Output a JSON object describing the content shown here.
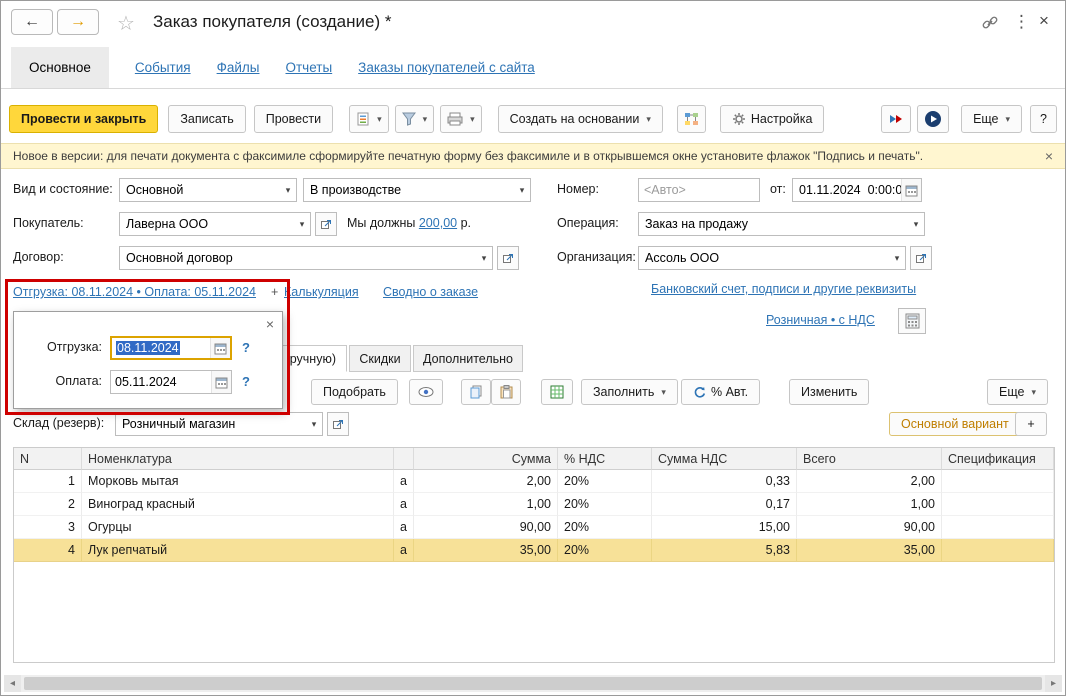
{
  "header": {
    "title": "Заказ покупателя (создание) *"
  },
  "icons": {
    "back": "←",
    "forward": "→",
    "favorite": "☆",
    "kebab": "⋮",
    "close": "×",
    "dropdown": "▾",
    "scroll_left": "◂",
    "scroll_right": "▸"
  },
  "sections": [
    "Основное",
    "События",
    "Файлы",
    "Отчеты",
    "Заказы покупателей с сайта"
  ],
  "toolbar": {
    "post_and_close": "Провести и закрыть",
    "save": "Записать",
    "post": "Провести",
    "create_based_on": "Создать на основании",
    "settings": "Настройка",
    "more": "Еще",
    "help": "?"
  },
  "notice": {
    "text": "Новое в версии: для печати документа с факсимиле сформируйте печатную форму без факсимиле и в открывшемся окне установите флажок \"Подпись и печать\"."
  },
  "fields": {
    "kind_state_label": "Вид и состояние:",
    "kind_value": "Основной",
    "state_value": "В производстве",
    "number_label": "Номер:",
    "number_placeholder": "<Авто>",
    "from_label": "от:",
    "date_value": "01.11.2024  0:00:00",
    "buyer_label": "Покупатель:",
    "buyer_value": "Лаверна ООО",
    "debt_prefix": "Мы должны ",
    "debt_amount": "200,00",
    "debt_suffix": " р.",
    "operation_label": "Операция:",
    "operation_value": "Заказ на продажу",
    "contract_label": "Договор:",
    "contract_value": "Основной договор",
    "org_label": "Организация:",
    "org_value": "Ассоль ООО"
  },
  "links": {
    "shipment_payment": "Отгрузка: 08.11.2024 • Оплата: 05.11.2024",
    "plus": "+",
    "calculation": "Калькуляция",
    "order_summary": "Сводно о заказе",
    "bank_details": "Банковский счет, подписи и другие реквизиты",
    "price_kind": "Розничная • с НДС"
  },
  "popup": {
    "shipment_label": "Отгрузка:",
    "shipment_value": "08.11.2024",
    "payment_label": "Оплата:",
    "payment_value": "05.11.2024",
    "help": "?"
  },
  "tabs": [
    "ручную)",
    "Скидки",
    "Дополнительно"
  ],
  "items_toolbar": {
    "pick": "Подобрать",
    "fill": "Заполнить",
    "auto_percent": "% Авт.",
    "edit": "Изменить",
    "more": "Еще"
  },
  "warehouse": {
    "label": "Склад (резерв):",
    "value": "Розничный магазин"
  },
  "variant": {
    "main": "Основной вариант",
    "add": "+"
  },
  "table": {
    "columns": [
      "N",
      "Номенклатура",
      "",
      "Сумма",
      "% НДС",
      "Сумма НДС",
      "Всего",
      "Спецификация"
    ],
    "rows": [
      {
        "n": "1",
        "name": "Морковь мытая",
        "frag": "а",
        "amount": "2,00",
        "vat": "20%",
        "vat_amount": "0,33",
        "total": "2,00"
      },
      {
        "n": "2",
        "name": "Виноград красный",
        "frag": "а",
        "amount": "1,00",
        "vat": "20%",
        "vat_amount": "0,17",
        "total": "1,00"
      },
      {
        "n": "3",
        "name": "Огурцы",
        "frag": "а",
        "amount": "90,00",
        "vat": "20%",
        "vat_amount": "15,00",
        "total": "90,00"
      },
      {
        "n": "4",
        "name": "Лук репчатый",
        "frag": "а",
        "amount": "35,00",
        "vat": "20%",
        "vat_amount": "5,83",
        "total": "35,00"
      }
    ]
  }
}
